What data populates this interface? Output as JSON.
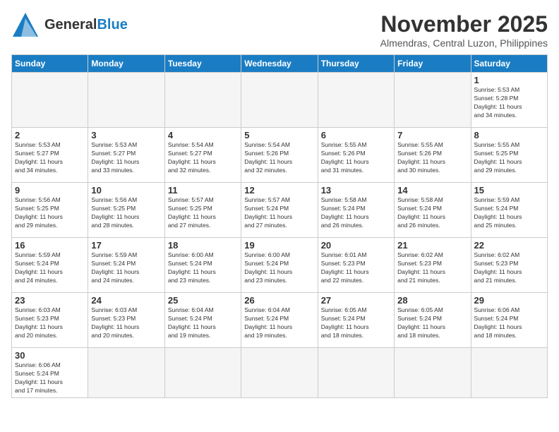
{
  "header": {
    "logo_general": "General",
    "logo_blue": "Blue",
    "month_title": "November 2025",
    "location": "Almendras, Central Luzon, Philippines"
  },
  "days_of_week": [
    "Sunday",
    "Monday",
    "Tuesday",
    "Wednesday",
    "Thursday",
    "Friday",
    "Saturday"
  ],
  "weeks": [
    [
      {
        "day": "",
        "info": "",
        "empty": true
      },
      {
        "day": "",
        "info": "",
        "empty": true
      },
      {
        "day": "",
        "info": "",
        "empty": true
      },
      {
        "day": "",
        "info": "",
        "empty": true
      },
      {
        "day": "",
        "info": "",
        "empty": true
      },
      {
        "day": "",
        "info": "",
        "empty": true
      },
      {
        "day": "1",
        "info": "Sunrise: 5:53 AM\nSunset: 5:28 PM\nDaylight: 11 hours\nand 34 minutes."
      }
    ],
    [
      {
        "day": "2",
        "info": "Sunrise: 5:53 AM\nSunset: 5:27 PM\nDaylight: 11 hours\nand 34 minutes."
      },
      {
        "day": "3",
        "info": "Sunrise: 5:53 AM\nSunset: 5:27 PM\nDaylight: 11 hours\nand 33 minutes."
      },
      {
        "day": "4",
        "info": "Sunrise: 5:54 AM\nSunset: 5:27 PM\nDaylight: 11 hours\nand 32 minutes."
      },
      {
        "day": "5",
        "info": "Sunrise: 5:54 AM\nSunset: 5:26 PM\nDaylight: 11 hours\nand 32 minutes."
      },
      {
        "day": "6",
        "info": "Sunrise: 5:55 AM\nSunset: 5:26 PM\nDaylight: 11 hours\nand 31 minutes."
      },
      {
        "day": "7",
        "info": "Sunrise: 5:55 AM\nSunset: 5:26 PM\nDaylight: 11 hours\nand 30 minutes."
      },
      {
        "day": "8",
        "info": "Sunrise: 5:55 AM\nSunset: 5:25 PM\nDaylight: 11 hours\nand 29 minutes."
      }
    ],
    [
      {
        "day": "9",
        "info": "Sunrise: 5:56 AM\nSunset: 5:25 PM\nDaylight: 11 hours\nand 29 minutes."
      },
      {
        "day": "10",
        "info": "Sunrise: 5:56 AM\nSunset: 5:25 PM\nDaylight: 11 hours\nand 28 minutes."
      },
      {
        "day": "11",
        "info": "Sunrise: 5:57 AM\nSunset: 5:25 PM\nDaylight: 11 hours\nand 27 minutes."
      },
      {
        "day": "12",
        "info": "Sunrise: 5:57 AM\nSunset: 5:24 PM\nDaylight: 11 hours\nand 27 minutes."
      },
      {
        "day": "13",
        "info": "Sunrise: 5:58 AM\nSunset: 5:24 PM\nDaylight: 11 hours\nand 26 minutes."
      },
      {
        "day": "14",
        "info": "Sunrise: 5:58 AM\nSunset: 5:24 PM\nDaylight: 11 hours\nand 26 minutes."
      },
      {
        "day": "15",
        "info": "Sunrise: 5:59 AM\nSunset: 5:24 PM\nDaylight: 11 hours\nand 25 minutes."
      }
    ],
    [
      {
        "day": "16",
        "info": "Sunrise: 5:59 AM\nSunset: 5:24 PM\nDaylight: 11 hours\nand 24 minutes."
      },
      {
        "day": "17",
        "info": "Sunrise: 5:59 AM\nSunset: 5:24 PM\nDaylight: 11 hours\nand 24 minutes."
      },
      {
        "day": "18",
        "info": "Sunrise: 6:00 AM\nSunset: 5:24 PM\nDaylight: 11 hours\nand 23 minutes."
      },
      {
        "day": "19",
        "info": "Sunrise: 6:00 AM\nSunset: 5:24 PM\nDaylight: 11 hours\nand 23 minutes."
      },
      {
        "day": "20",
        "info": "Sunrise: 6:01 AM\nSunset: 5:23 PM\nDaylight: 11 hours\nand 22 minutes."
      },
      {
        "day": "21",
        "info": "Sunrise: 6:02 AM\nSunset: 5:23 PM\nDaylight: 11 hours\nand 21 minutes."
      },
      {
        "day": "22",
        "info": "Sunrise: 6:02 AM\nSunset: 5:23 PM\nDaylight: 11 hours\nand 21 minutes."
      }
    ],
    [
      {
        "day": "23",
        "info": "Sunrise: 6:03 AM\nSunset: 5:23 PM\nDaylight: 11 hours\nand 20 minutes."
      },
      {
        "day": "24",
        "info": "Sunrise: 6:03 AM\nSunset: 5:23 PM\nDaylight: 11 hours\nand 20 minutes."
      },
      {
        "day": "25",
        "info": "Sunrise: 6:04 AM\nSunset: 5:24 PM\nDaylight: 11 hours\nand 19 minutes."
      },
      {
        "day": "26",
        "info": "Sunrise: 6:04 AM\nSunset: 5:24 PM\nDaylight: 11 hours\nand 19 minutes."
      },
      {
        "day": "27",
        "info": "Sunrise: 6:05 AM\nSunset: 5:24 PM\nDaylight: 11 hours\nand 18 minutes."
      },
      {
        "day": "28",
        "info": "Sunrise: 6:05 AM\nSunset: 5:24 PM\nDaylight: 11 hours\nand 18 minutes."
      },
      {
        "day": "29",
        "info": "Sunrise: 6:06 AM\nSunset: 5:24 PM\nDaylight: 11 hours\nand 18 minutes."
      }
    ],
    [
      {
        "day": "30",
        "info": "Sunrise: 6:06 AM\nSunset: 5:24 PM\nDaylight: 11 hours\nand 17 minutes."
      },
      {
        "day": "",
        "info": "",
        "empty": true
      },
      {
        "day": "",
        "info": "",
        "empty": true
      },
      {
        "day": "",
        "info": "",
        "empty": true
      },
      {
        "day": "",
        "info": "",
        "empty": true
      },
      {
        "day": "",
        "info": "",
        "empty": true
      },
      {
        "day": "",
        "info": "",
        "empty": true
      }
    ]
  ]
}
